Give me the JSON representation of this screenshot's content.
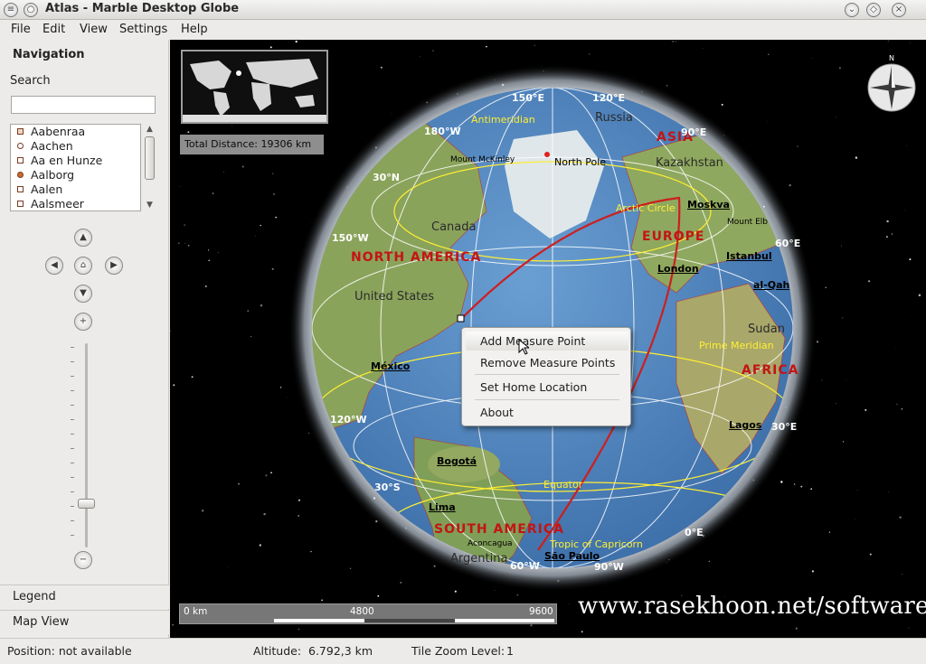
{
  "window": {
    "title": "Atlas - Marble Desktop Globe"
  },
  "menu": [
    "File",
    "Edit",
    "View",
    "Settings",
    "Help"
  ],
  "sidebar": {
    "title": "Navigation",
    "search_label": "Search",
    "search_value": "",
    "places": [
      "Aabenraa",
      "Aachen",
      "Aa en Hunze",
      "Aalborg",
      "Aalen",
      "Aalsmeer"
    ],
    "tabs": [
      "Legend",
      "Map View"
    ]
  },
  "map": {
    "total_distance": "Total Distance: 19306 km",
    "scale": {
      "start": "0 km",
      "mid": "4800",
      "end": "9600"
    },
    "watermark": "www.rasekhoon.net/software",
    "compass_letter": "N",
    "continents": [
      "Asia",
      "Europe",
      "North America",
      "Africa",
      "South America"
    ],
    "countries": [
      "Russia",
      "Kazakhstan",
      "Canada",
      "United States",
      "Sudan",
      "Argentina"
    ],
    "cities": [
      "Moskva",
      "London",
      "Istanbul",
      "al-Qah",
      "México",
      "Bogotá",
      "Lima",
      "Lagos",
      "São Paulo",
      "Aconcagua",
      "Mount McKinley",
      "Mount Elb",
      "North Pole"
    ],
    "lines": [
      "Antimeridian",
      "Equator",
      "Prime Meridian",
      "Arctic Circle",
      "Tropic of Capricorn"
    ],
    "grid_labels": [
      "150°E",
      "120°E",
      "90°E",
      "180°W",
      "150°W",
      "120°W",
      "30°N",
      "30°S",
      "60°E",
      "30°E",
      "0°E",
      "60°W",
      "90°W"
    ]
  },
  "context_menu": {
    "items": [
      {
        "label": "Add Measure Point",
        "highlighted": true
      },
      {
        "label": "Remove Measure Points",
        "highlighted": false
      },
      {
        "label": "Set Home Location",
        "highlighted": false
      },
      {
        "label": "About",
        "highlighted": false
      }
    ]
  },
  "status": {
    "position": "Position: not available",
    "altitude_label": "Altitude:",
    "altitude_value": "6.792,3 km",
    "zoom_label": "Tile Zoom Level:",
    "zoom_value": "1"
  },
  "colors": {
    "ocean": "#4f86c1",
    "land": "#8aa85c",
    "measure_line": "#cc1f1f",
    "continent_label": "#c41414",
    "grid_label": "#ffffff",
    "special_line": "#ffee33"
  }
}
